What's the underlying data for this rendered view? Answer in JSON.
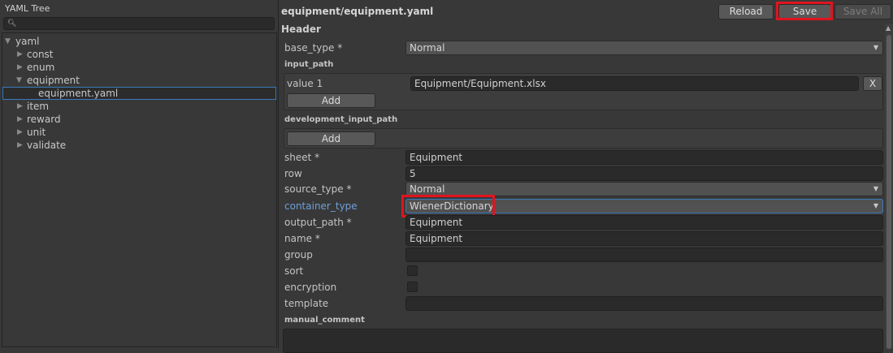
{
  "left_panel": {
    "title": "YAML Tree",
    "search_placeholder": "",
    "tree": [
      {
        "label": "yaml",
        "expanded": true
      },
      {
        "label": "const",
        "expanded": false
      },
      {
        "label": "enum",
        "expanded": false
      },
      {
        "label": "equipment",
        "expanded": true
      },
      {
        "label": "equipment.yaml",
        "selected": true
      },
      {
        "label": "item",
        "expanded": false
      },
      {
        "label": "reward",
        "expanded": false
      },
      {
        "label": "unit",
        "expanded": false
      },
      {
        "label": "validate",
        "expanded": false
      }
    ]
  },
  "header": {
    "path": "equipment/equipment.yaml",
    "reload_label": "Reload",
    "save_label": "Save",
    "save_all_label": "Save All",
    "section_label": "Header"
  },
  "form": {
    "base_type": {
      "label": "base_type *",
      "value": "Normal"
    },
    "input_path": {
      "label": "input_path",
      "item_label": "value 1",
      "item_value": "Equipment/Equipment.xlsx",
      "remove_label": "X",
      "add_label": "Add"
    },
    "development_input_path": {
      "label": "development_input_path",
      "add_label": "Add"
    },
    "sheet": {
      "label": "sheet *",
      "value": "Equipment"
    },
    "row": {
      "label": "row",
      "value": "5"
    },
    "source_type": {
      "label": "source_type *",
      "value": "Normal"
    },
    "container_type": {
      "label": "container_type",
      "value": "WienerDictionary"
    },
    "output_path": {
      "label": "output_path *",
      "value": "Equipment"
    },
    "name": {
      "label": "name *",
      "value": "Equipment"
    },
    "group": {
      "label": "group",
      "value": ""
    },
    "sort": {
      "label": "sort",
      "checked": false
    },
    "encryption": {
      "label": "encryption",
      "checked": false
    },
    "template": {
      "label": "template",
      "value": ""
    },
    "manual_comment": {
      "label": "manual_comment",
      "value": ""
    }
  },
  "colors": {
    "highlight": "#e0141e",
    "focus_label": "#6f9fd8",
    "selection_border": "#3a79bb"
  }
}
